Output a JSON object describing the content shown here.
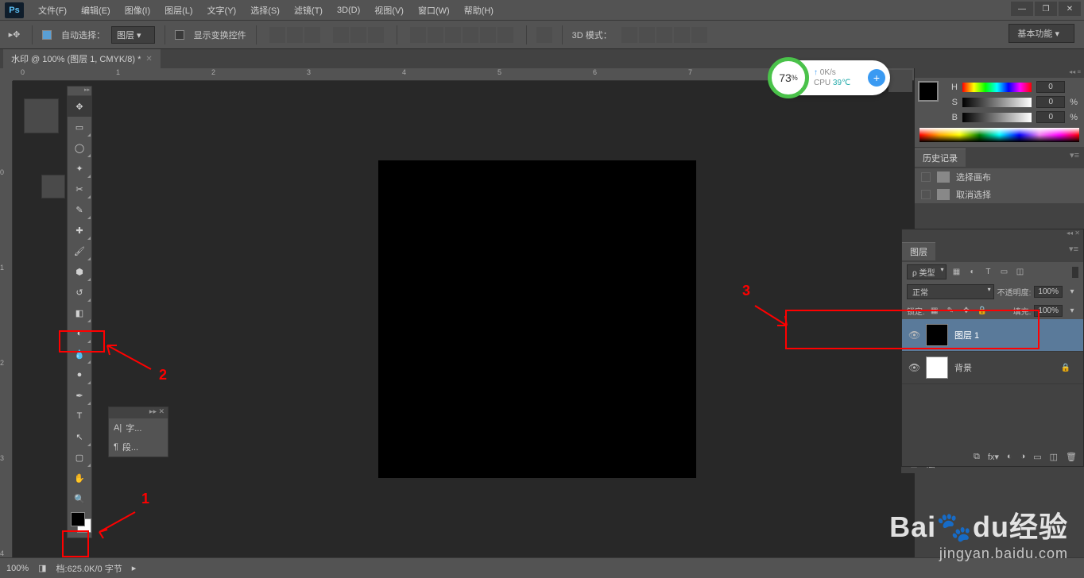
{
  "menu": {
    "items": [
      "文件(F)",
      "编辑(E)",
      "图像(I)",
      "图层(L)",
      "文字(Y)",
      "选择(S)",
      "滤镜(T)",
      "3D(D)",
      "视图(V)",
      "窗口(W)",
      "帮助(H)"
    ]
  },
  "options": {
    "auto_select_label": "自动选择：",
    "auto_select_value": "图层",
    "show_transform_label": "显示变换控件",
    "mode_3d_label": "3D 模式："
  },
  "workspace_button": "基本功能",
  "document_tab": "水印 @ 100% (图层 1, CMYK/8) *",
  "ruler_h_marks": [
    "0",
    "1",
    "2",
    "3",
    "4",
    "5",
    "6",
    "7"
  ],
  "ruler_v_marks": [
    "0",
    "1",
    "2",
    "3",
    "4"
  ],
  "char_panel": {
    "row1": "字...",
    "row2": "段..."
  },
  "color_panel": {
    "h_label": "H",
    "h_val": "0",
    "s_label": "S",
    "s_val": "0",
    "s_unit": "%",
    "b_label": "B",
    "b_val": "0",
    "b_unit": "%"
  },
  "history_panel": {
    "title": "历史记录",
    "items": [
      "选择画布",
      "取消选择"
    ]
  },
  "layers_panel": {
    "title": "图层",
    "kind_label": "类型",
    "blend_mode": "正常",
    "opacity_label": "不透明度:",
    "opacity_val": "100%",
    "lock_label": "锁定:",
    "fill_label": "填充:",
    "fill_val": "100%",
    "layers": [
      {
        "name": "图层 1",
        "thumb": "black",
        "selected": true,
        "locked": false
      },
      {
        "name": "背景",
        "thumb": "white",
        "selected": false,
        "locked": true
      }
    ]
  },
  "collapsed2": {
    "i1": "层"
  },
  "status": {
    "zoom": "100%",
    "doc_info": "档:625.0K/0 字节"
  },
  "annotations": {
    "n1": "1",
    "n2": "2",
    "n3": "3"
  },
  "cpu": {
    "pct": "73",
    "pct_unit": "%",
    "net_up": "↑",
    "net": "0K/s",
    "cpu_label": "CPU",
    "temp": "39℃"
  },
  "watermark": {
    "brand_b": "Bai",
    "brand_du": "du",
    "brand_cn": "经验",
    "sub": "jingyan.baidu.com"
  }
}
